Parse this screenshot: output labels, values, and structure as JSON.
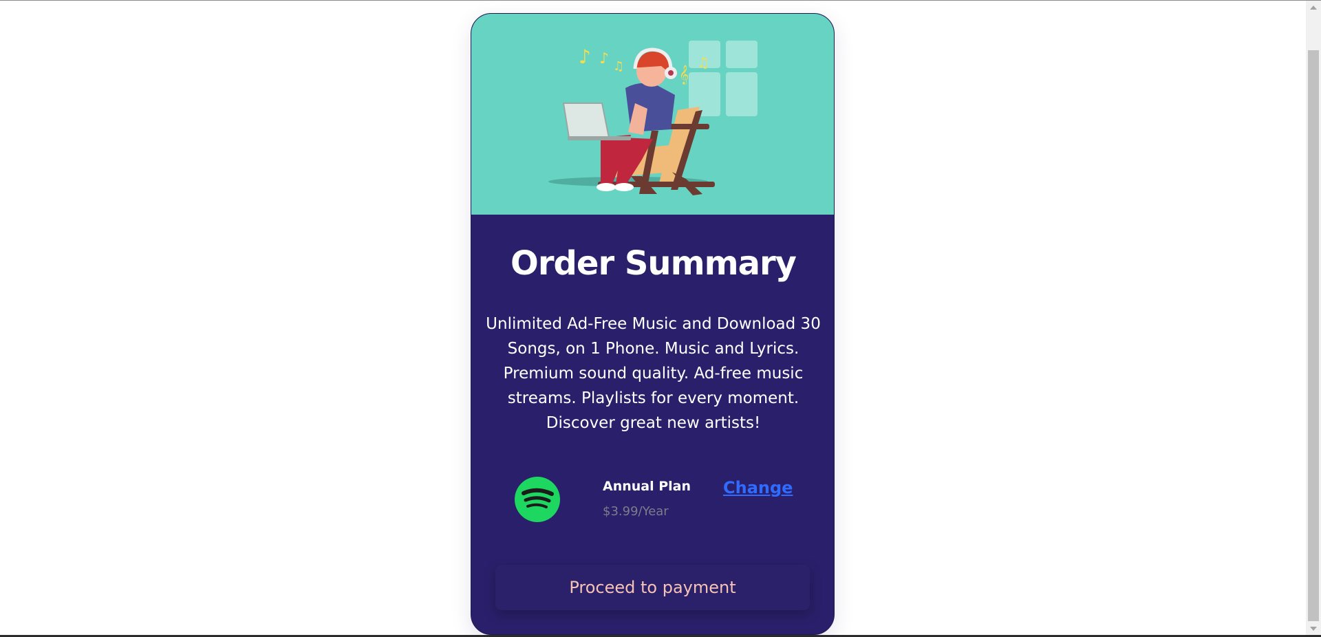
{
  "card": {
    "title": "Order Summary",
    "description": "Unlimited Ad-Free Music and Download 30 Songs, on 1 Phone. Music and Lyrics. Premium sound quality. Ad-free music streams. Playlists for every moment. Discover great new artists!",
    "hero_illustration": "person-listening-music-laptop-illustration"
  },
  "plan": {
    "logo_icon": "spotify-logo-icon",
    "name": "Annual Plan",
    "price": "$3.99/Year",
    "change_label": "Change"
  },
  "actions": {
    "proceed_label": "Proceed to payment"
  },
  "colors": {
    "hero_bg": "#67d3c3",
    "card_bg": "#2a1f6a",
    "link": "#2f6bff",
    "button_text": "#f6c3b4",
    "logo_green": "#1ed760"
  }
}
